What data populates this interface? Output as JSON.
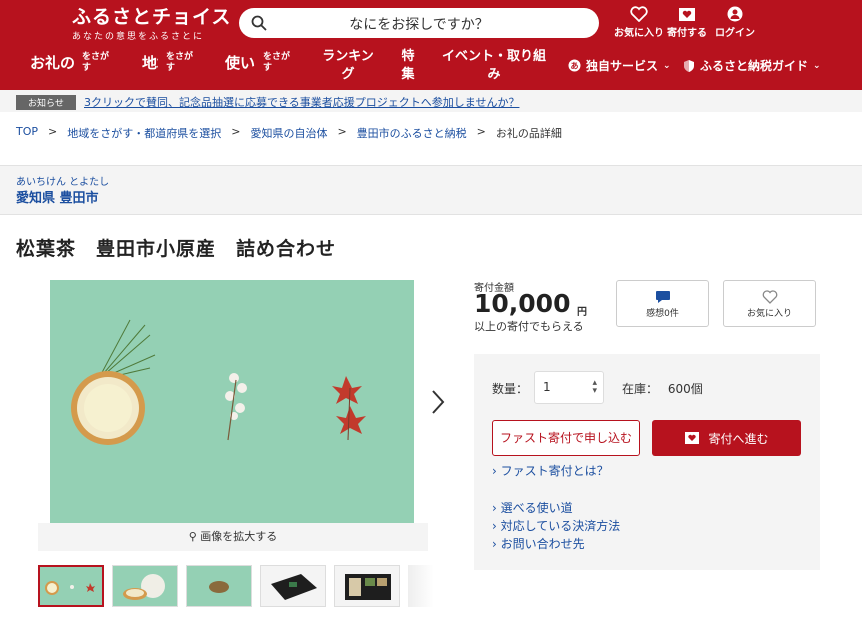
{
  "header": {
    "logo_main": "ふるさとチョイス",
    "logo_sub": "あなたの意思をふるさとに",
    "search_placeholder": "なにをお探しですか？",
    "icons": [
      {
        "label": "お気に入り",
        "icon": "heart-icon"
      },
      {
        "label": "寄付する",
        "icon": "donate-box-icon"
      },
      {
        "label": "ログイン",
        "icon": "user-icon"
      }
    ]
  },
  "nav": {
    "gifts": {
      "big": "お礼の品",
      "small": "をさがす"
    },
    "region": {
      "big": "地域",
      "small": "をさがす"
    },
    "usage": {
      "big": "使い道",
      "small": "をさがす"
    },
    "ranking": "ランキング",
    "feature": "特集",
    "events": "イベント・取り組み",
    "services": "独自サービス",
    "guide": "ふるさと納税ガイド"
  },
  "notice": {
    "badge": "お知らせ",
    "text": "3クリックで賛同、記念品抽選に応募できる事業者応援プロジェクトへ参加しませんか？"
  },
  "breadcrumb": [
    "TOP",
    "地域をさがす・都道府県を選択",
    "愛知県の自治体",
    "豊田市のふるさと納税",
    "お礼の品詳細"
  ],
  "location": {
    "ruby": "あいちけん とよたし",
    "name": "愛知県 豊田市"
  },
  "product": {
    "title": "松葉茶　豊田市小原産　詰め合わせ",
    "zoom_label": "画像を拡大する",
    "donation_label": "寄付金額",
    "amount": "10,000",
    "yen": "円",
    "note": "以上の寄付でもらえる",
    "review_label": "感想0件",
    "favorite_label": "お気に入り",
    "qty_label": "数量：",
    "qty_value": "1",
    "stock_label": "在庫：",
    "stock_value": "600個",
    "fast_button": "ファスト寄付で申し込む",
    "donate_button": "寄付へ進む",
    "link_fast": "› ファスト寄付とは？",
    "link_usage": "› 選べる使い道",
    "link_payment": "› 対応している決済方法",
    "link_contact": "› お問い合わせ先"
  },
  "colors": {
    "brand": "#b7121e",
    "link": "#1c4fa0",
    "image_bg": "#94d0b4"
  }
}
